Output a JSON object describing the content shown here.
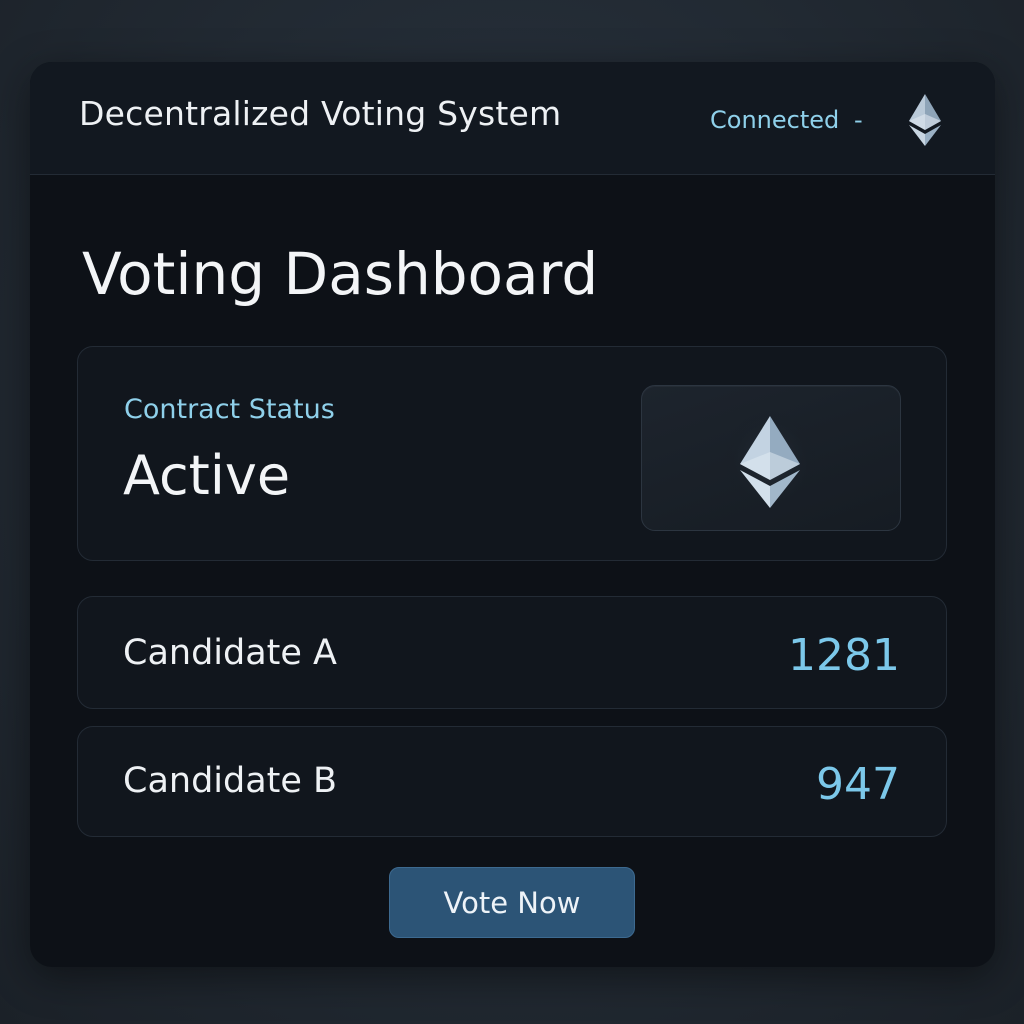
{
  "header": {
    "app_title": "Decentralized Voting System",
    "connection_status": "Connected",
    "separator": "-",
    "network_icon": "ethereum-icon"
  },
  "main": {
    "page_title": "Voting Dashboard",
    "contract": {
      "label": "Contract Status",
      "value": "Active",
      "icon": "ethereum-icon"
    },
    "candidates": [
      {
        "name": "Candidate A",
        "votes": "1281"
      },
      {
        "name": "Candidate B",
        "votes": "947"
      }
    ],
    "vote_button_label": "Vote Now"
  },
  "colors": {
    "accent": "#8fd0ea",
    "button": "#2c5476",
    "background": "#0d1117",
    "card": "#11161d"
  }
}
